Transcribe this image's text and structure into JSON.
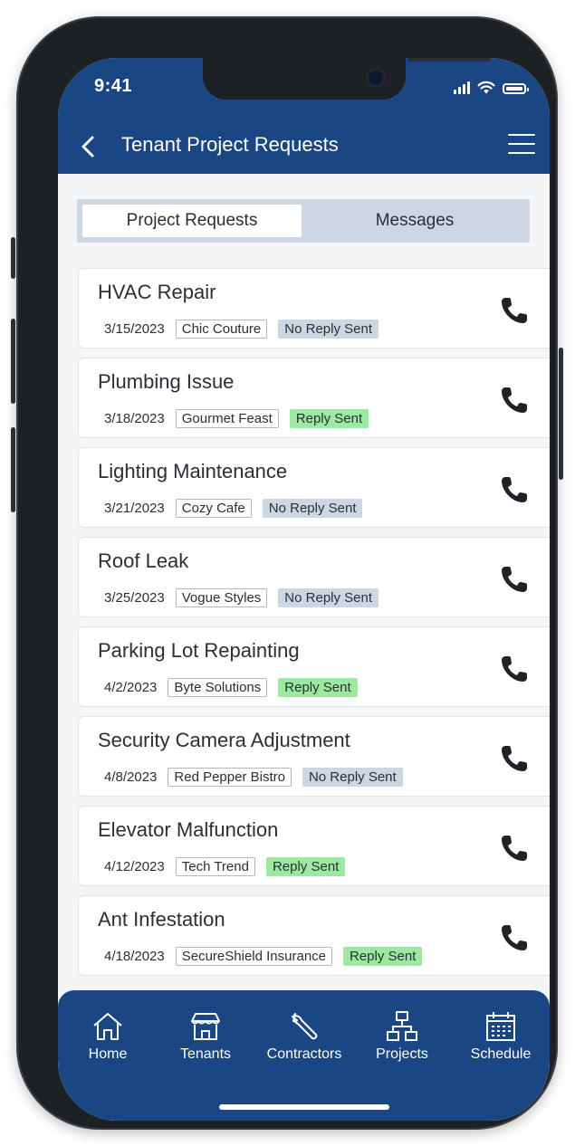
{
  "status_bar": {
    "time": "9:41"
  },
  "header": {
    "title": "Tenant Project Requests"
  },
  "segments": {
    "active": "Project Requests",
    "inactive": "Messages"
  },
  "colors": {
    "brand": "#1b4684",
    "reply_sent_bg": "#9ceaa0",
    "no_reply_bg": "#cdd7e3"
  },
  "requests": [
    {
      "title": "HVAC Repair",
      "date": "3/15/2023",
      "tenant": "Chic Couture",
      "status": "No Reply Sent"
    },
    {
      "title": "Plumbing Issue",
      "date": "3/18/2023",
      "tenant": "Gourmet Feast",
      "status": "Reply Sent"
    },
    {
      "title": "Lighting Maintenance",
      "date": "3/21/2023",
      "tenant": "Cozy Cafe",
      "status": "No Reply Sent"
    },
    {
      "title": "Roof Leak",
      "date": "3/25/2023",
      "tenant": "Vogue Styles",
      "status": "No Reply Sent"
    },
    {
      "title": "Parking Lot Repainting",
      "date": "4/2/2023",
      "tenant": "Byte Solutions",
      "status": "Reply Sent"
    },
    {
      "title": "Security Camera Adjustment",
      "date": "4/8/2023",
      "tenant": "Red Pepper Bistro",
      "status": "No Reply Sent"
    },
    {
      "title": "Elevator Malfunction",
      "date": "4/12/2023",
      "tenant": "Tech Trend",
      "status": "Reply Sent"
    },
    {
      "title": "Ant Infestation",
      "date": "4/18/2023",
      "tenant": "SecureShield Insurance",
      "status": "Reply Sent"
    }
  ],
  "tabbar": {
    "items": [
      {
        "label": "Home",
        "icon": "home-icon"
      },
      {
        "label": "Tenants",
        "icon": "storefront-icon"
      },
      {
        "label": "Contractors",
        "icon": "wrench-icon"
      },
      {
        "label": "Projects",
        "icon": "hierarchy-icon"
      },
      {
        "label": "Schedule",
        "icon": "calendar-icon"
      }
    ]
  }
}
